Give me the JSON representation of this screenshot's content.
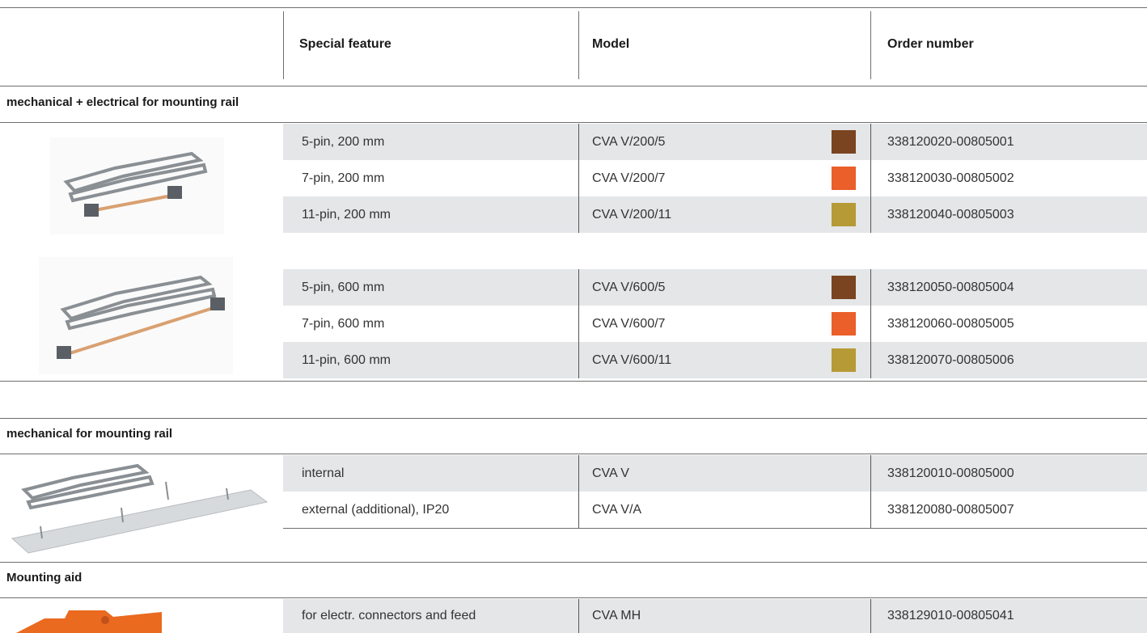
{
  "header": {
    "col_feature": "Special feature",
    "col_model": "Model",
    "col_order": "Order number"
  },
  "sections": [
    {
      "title": "mechanical + electrical for mounting rail",
      "groups": [
        {
          "image_icon": "rail-connector-200mm-image",
          "rows": [
            {
              "feature": "5-pin, 200 mm",
              "model": "CVA V/200/5",
              "color": "#7a4420",
              "order": "338120020-00805001"
            },
            {
              "feature": "7-pin, 200 mm",
              "model": "CVA V/200/7",
              "color": "#ea5f2a",
              "order": "338120030-00805002"
            },
            {
              "feature": "11-pin, 200 mm",
              "model": "CVA V/200/11",
              "color": "#b69a36",
              "order": "338120040-00805003"
            }
          ]
        },
        {
          "image_icon": "rail-connector-600mm-image",
          "rows": [
            {
              "feature": "5-pin, 600 mm",
              "model": "CVA V/600/5",
              "color": "#7a4420",
              "order": "338120050-00805004"
            },
            {
              "feature": "7-pin, 600 mm",
              "model": "CVA V/600/7",
              "color": "#ea5f2a",
              "order": "338120060-00805005"
            },
            {
              "feature": "11-pin, 600 mm",
              "model": "CVA V/600/11",
              "color": "#b69a36",
              "order": "338120070-00805006"
            }
          ]
        }
      ]
    },
    {
      "title": "mechanical for mounting rail",
      "groups": [
        {
          "image_icon": "rail-connector-mechanical-image",
          "rows": [
            {
              "feature": "internal",
              "model": "CVA V",
              "order": "338120010-00805000"
            },
            {
              "feature": "external (additional), IP20",
              "model": "CVA V/A",
              "order": "338120080-00805007"
            }
          ]
        }
      ]
    },
    {
      "title": "Mounting aid",
      "groups": [
        {
          "image_icon": "mounting-aid-orange-image",
          "rows": [
            {
              "feature": "for electr. connectors and feed",
              "model": "CVA MH",
              "order": "338129010-00805041"
            }
          ]
        }
      ]
    }
  ],
  "colors": {
    "brown": "#7a4420",
    "orange": "#ea5f2a",
    "olive": "#b69a36",
    "row_shade": "#e4e6e8"
  }
}
